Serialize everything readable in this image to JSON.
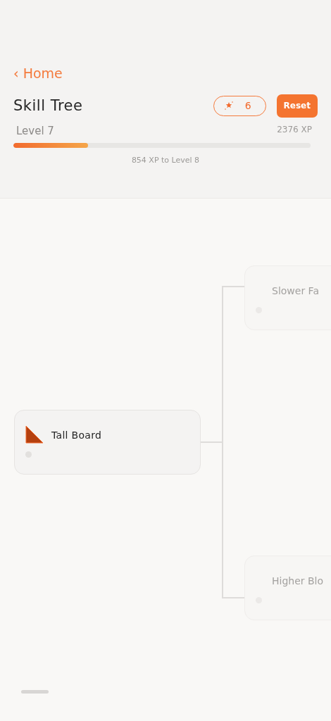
{
  "header": {
    "back_link": "‹ Home",
    "title": "Skill Tree",
    "points": "6",
    "reset_button": "Reset"
  },
  "progress": {
    "level_label": "Level 7",
    "xp": "2376 XP",
    "level": 0.25,
    "remaining": "854 XP to Level 8"
  },
  "tree": {
    "label": "Tall Board",
    "locked": false,
    "children": [
      {
        "label": "Slower Fa",
        "locked": true
      },
      {
        "label": "Higher Blo",
        "locked": true
      }
    ]
  }
}
